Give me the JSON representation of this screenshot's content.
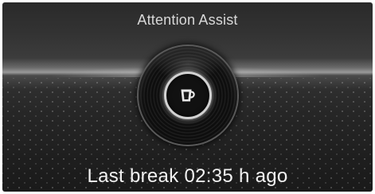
{
  "header": {
    "title": "Attention Assist"
  },
  "indicator": {
    "icon": "coffee-cup-icon"
  },
  "status": {
    "text": "Last break 02:35 h ago"
  },
  "colors": {
    "background_dark": "#1e1e1e",
    "ring": "#d2d2d2",
    "text": "#f2f2f2"
  }
}
